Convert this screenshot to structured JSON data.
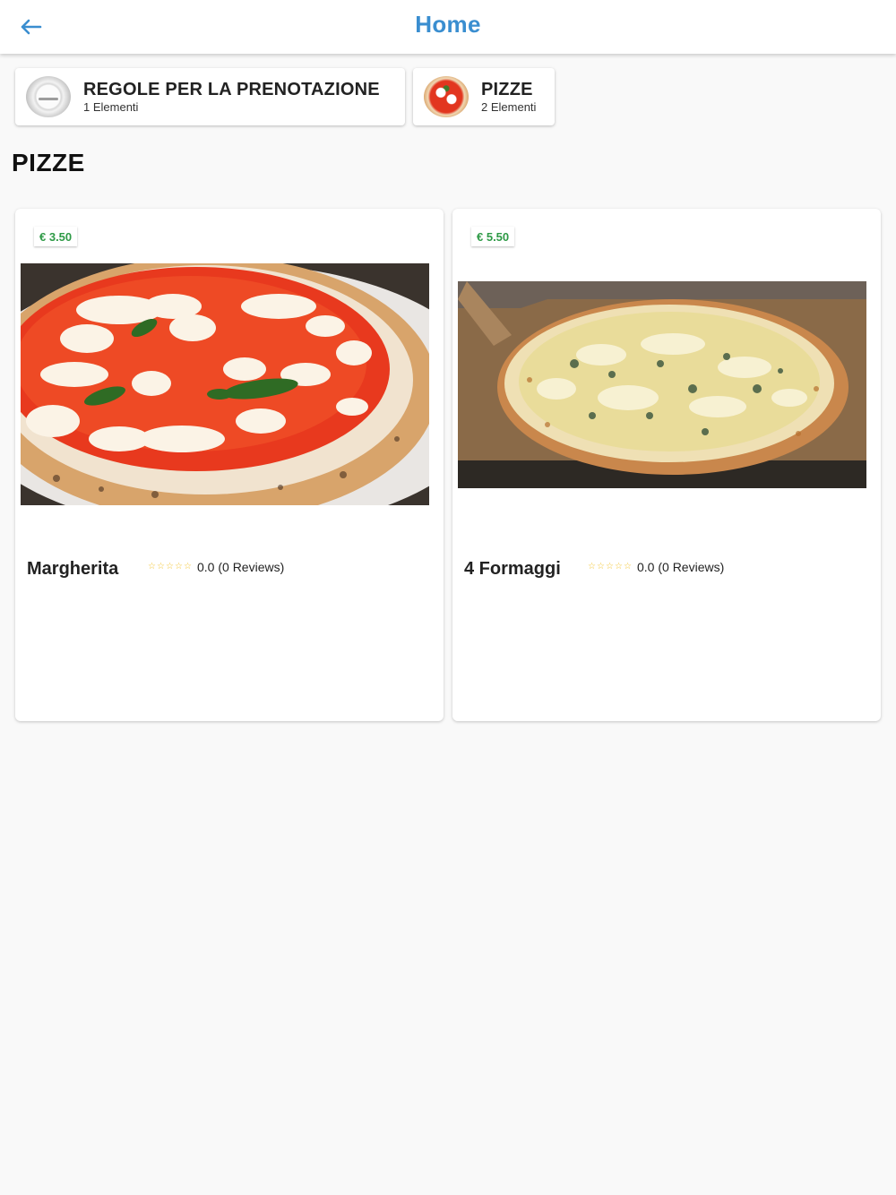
{
  "appbar": {
    "title": "Home",
    "back_icon": "arrow-left-icon",
    "accent_color": "#3a8ed0"
  },
  "categories": [
    {
      "title": "REGOLE PER LA PRENOTAZIONE",
      "subtitle": "1 Elementi",
      "icon": "plate-icon"
    },
    {
      "title": "PIZZE",
      "subtitle": "2 Elementi",
      "icon": "pizza-icon"
    }
  ],
  "section": {
    "title": "PIZZE"
  },
  "products": [
    {
      "name": "Margherita",
      "price": "€ 3.50",
      "rating": "0.0 (0 Reviews)",
      "stars": 0
    },
    {
      "name": "4 Formaggi",
      "price": "€ 5.50",
      "rating": "0.0 (0 Reviews)",
      "stars": 0
    }
  ],
  "colors": {
    "price": "#2e9a46",
    "star": "#f3c531"
  }
}
